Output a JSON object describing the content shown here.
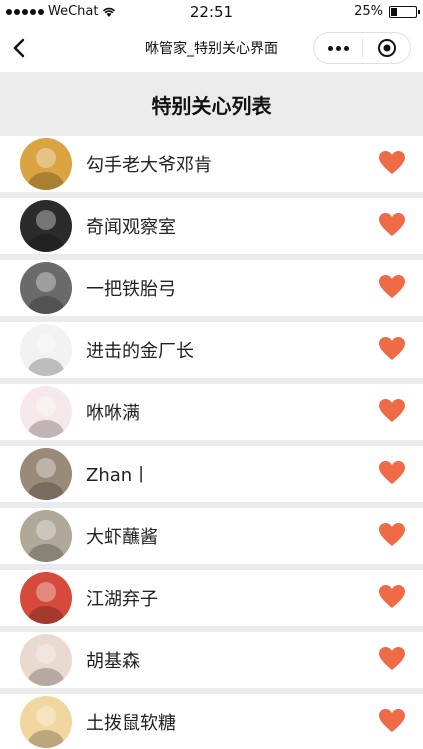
{
  "status": {
    "carrier": "WeChat",
    "time": "22:51",
    "battery": "25%",
    "battery_level": 0.25
  },
  "nav": {
    "title": "咻管家_特别关心界面",
    "back_icon": "chevron-left-icon",
    "more_icon": "more-dots-icon",
    "close_icon": "target-close-icon"
  },
  "page": {
    "title": "特别关心列表"
  },
  "colors": {
    "heart": "#ef6a47",
    "background": "#ebebeb",
    "row": "#ffffff"
  },
  "items": [
    {
      "name": "勾手老大爷邓肯",
      "avatar_bg": "#d9a441",
      "icon": "heart-icon"
    },
    {
      "name": "奇闻观察室",
      "avatar_bg": "#2b2b2b",
      "icon": "heart-icon"
    },
    {
      "name": "一把铁胎弓",
      "avatar_bg": "#6a6a6a",
      "icon": "heart-icon"
    },
    {
      "name": "进击的金厂长",
      "avatar_bg": "#f2f2f2",
      "icon": "heart-icon"
    },
    {
      "name": "咻咻满",
      "avatar_bg": "#f6e8ea",
      "icon": "heart-icon"
    },
    {
      "name": "Zhan丨",
      "avatar_bg": "#9a8a7a",
      "icon": "heart-icon"
    },
    {
      "name": "大虾蘸酱",
      "avatar_bg": "#b0a898",
      "icon": "heart-icon"
    },
    {
      "name": "江湖弃子",
      "avatar_bg": "#d54a3a",
      "icon": "heart-icon"
    },
    {
      "name": "胡基森",
      "avatar_bg": "#e9d9cf",
      "icon": "heart-icon"
    },
    {
      "name": "土拨鼠软糖",
      "avatar_bg": "#f1d6a0",
      "icon": "heart-icon"
    }
  ]
}
